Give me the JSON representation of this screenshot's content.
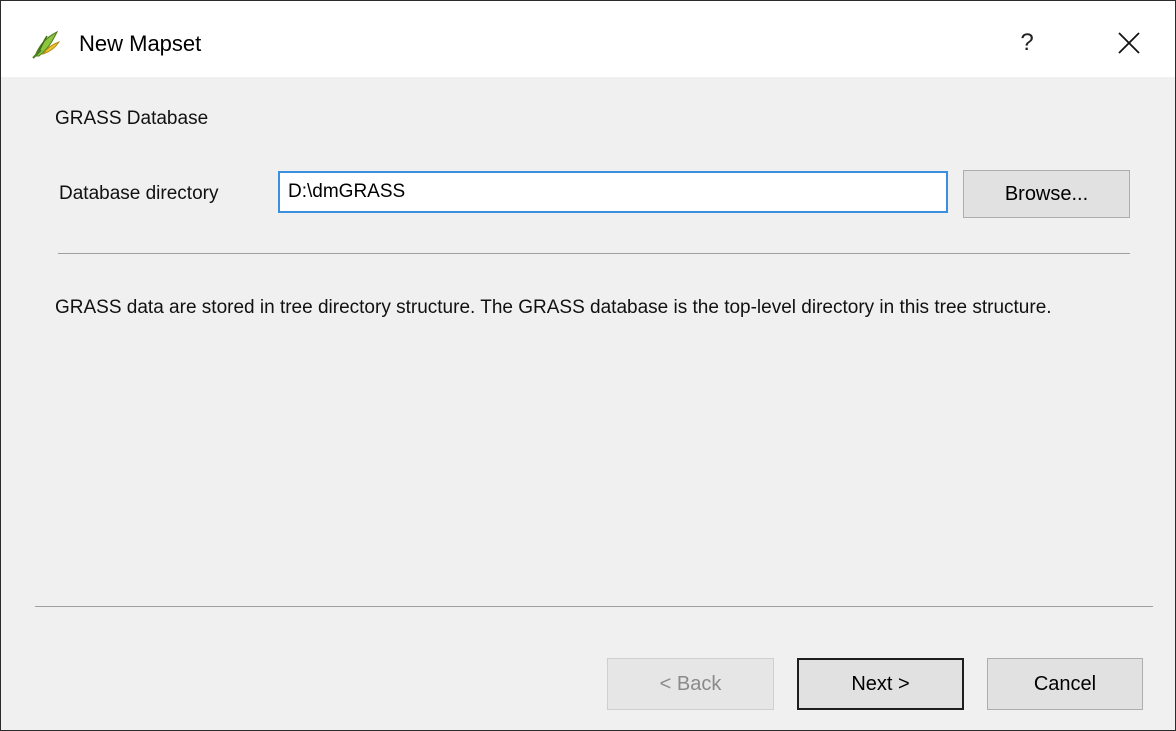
{
  "window": {
    "title": "New Mapset",
    "help_label": "?",
    "app_icon": "qgis-grass-icon",
    "close_icon": "close-icon"
  },
  "section": {
    "title": "GRASS Database"
  },
  "database": {
    "label": "Database directory",
    "value": "D:\\dmGRASS",
    "browse_label": "Browse..."
  },
  "description": "GRASS data are stored in tree directory structure. The GRASS database is the top-level directory in this tree structure.",
  "footer": {
    "back_label": "< Back",
    "next_label": "Next >",
    "cancel_label": "Cancel"
  },
  "colors": {
    "focus_border": "#3c8fdc",
    "dialog_bg": "#f0f0f0"
  }
}
